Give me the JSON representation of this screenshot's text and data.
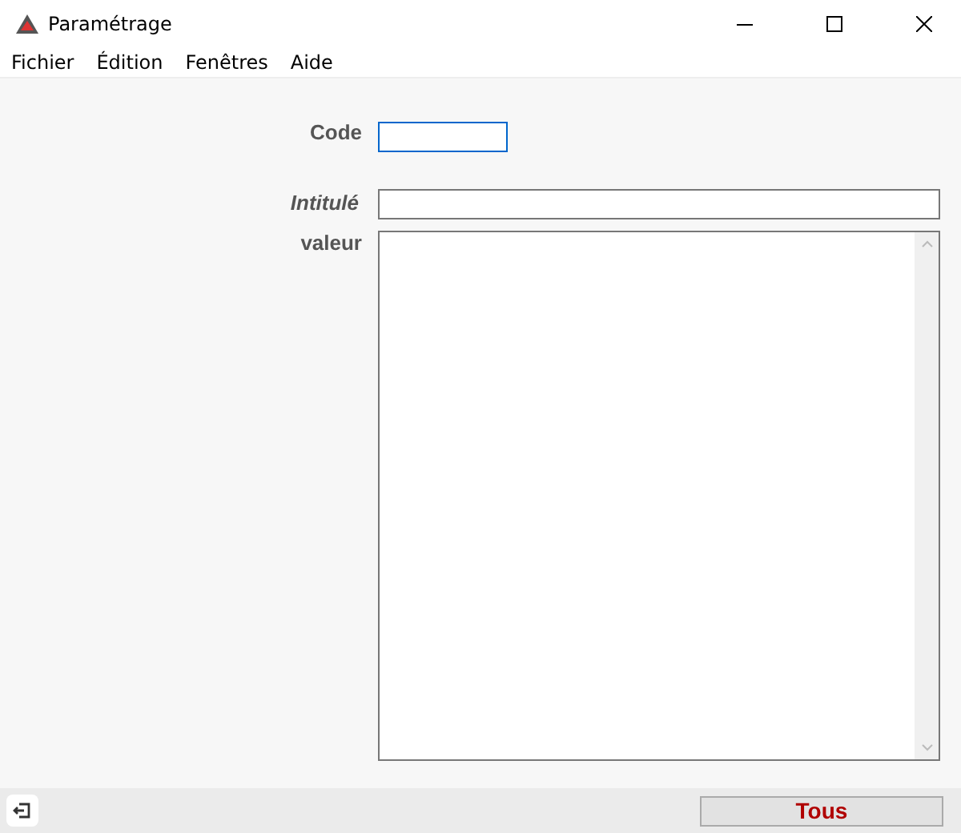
{
  "window": {
    "title": "Paramétrage"
  },
  "menu": [
    "Fichier",
    "Édition",
    "Fenêtres",
    "Aide"
  ],
  "form": {
    "code_label": "Code",
    "title_label": "Intitulé",
    "value_label": "valeur"
  },
  "footer": {
    "button": "Tous"
  }
}
